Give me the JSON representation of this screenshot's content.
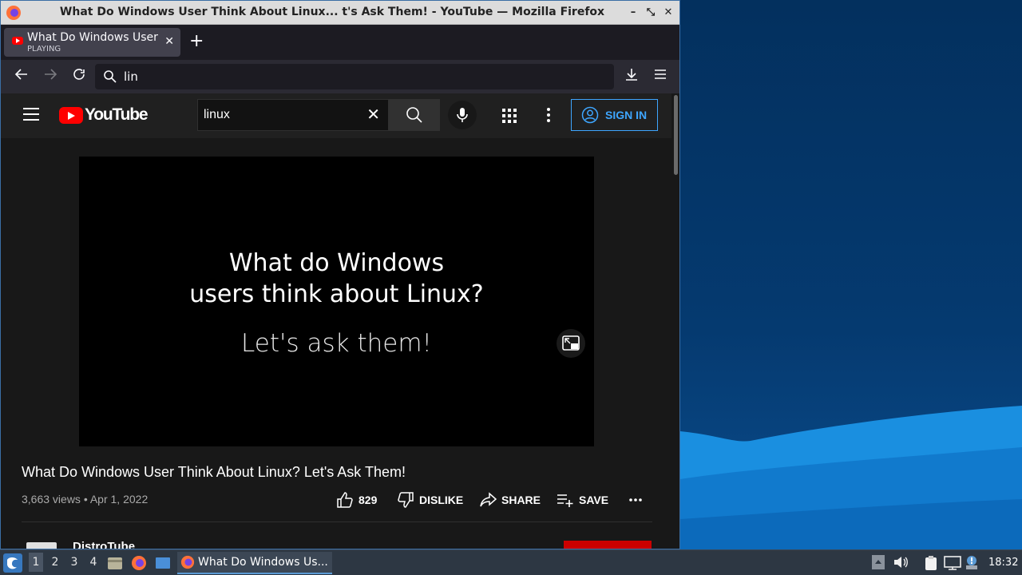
{
  "window": {
    "title": "What Do Windows User Think About Linux... t's Ask Them! - YouTube — Mozilla Firefox",
    "controls": [
      "minimize",
      "maximize",
      "close"
    ]
  },
  "tab": {
    "title": "What Do Windows User Think About Linux? Let's Ask Them!",
    "status": "PLAYING"
  },
  "navbar": {
    "url_text": "lin"
  },
  "youtube": {
    "logo_text": "YouTube",
    "search_value": "linux",
    "sign_in": "SIGN IN"
  },
  "video": {
    "slide_line1": "What do Windows",
    "slide_line2": "users think about Linux?",
    "slide_line3": "Let's ask them!",
    "title": "What Do Windows User Think About Linux? Let's Ask Them!",
    "meta": "3,663 views • Apr 1, 2022",
    "likes": "829",
    "dislike": "DISLIKE",
    "share": "SHARE",
    "save": "SAVE",
    "channel": "DistroTube"
  },
  "taskbar": {
    "workspaces": [
      "1",
      "2",
      "3",
      "4"
    ],
    "active_workspace": "1",
    "task_label": "What Do Windows Us...",
    "clock": "18:32"
  },
  "colors": {
    "accent_blue": "#3ea6ff",
    "yt_red": "#ff0000",
    "wallpaper": "#053a70"
  }
}
